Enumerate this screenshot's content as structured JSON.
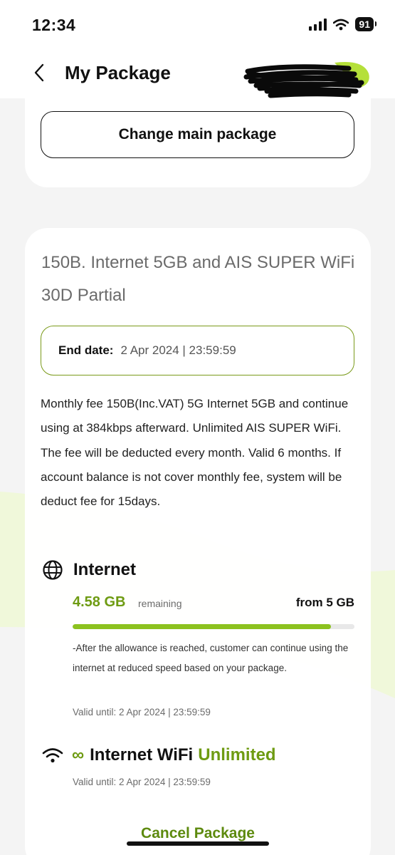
{
  "status_bar": {
    "time": "12:34",
    "battery": "91"
  },
  "header": {
    "title": "My Package"
  },
  "top_card": {
    "change_button_label": "Change main package"
  },
  "package": {
    "title": "150B. Internet 5GB and AIS SUPER WiFi 30D Partial",
    "end_date_label": "End date:",
    "end_date_value": "2 Apr 2024 | 23:59:59",
    "description": "Monthly fee 150B(Inc.VAT) 5G Internet 5GB and continue using at 384kbps afterward. Unlimited AIS SUPER WiFi. The fee will be deducted every month. Valid 6 months. If account balance is not cover monthly fee, system will be deduct fee for 15days."
  },
  "internet": {
    "name": "Internet",
    "remaining_value": "4.58 GB",
    "remaining_label": "remaining",
    "total": "from 5 GB",
    "remaining_fraction": 0.916,
    "note": "-After the allowance is reached, customer can continue using the internet at reduced speed based on your package.",
    "valid_until": "Valid until: 2 Apr 2024 | 23:59:59"
  },
  "wifi": {
    "infinity_symbol": "∞",
    "name": "Internet WiFi",
    "unlimited": "Unlimited",
    "valid_until": "Valid until: 2 Apr 2024 | 23:59:59"
  },
  "actions": {
    "cancel_label": "Cancel Package"
  },
  "colors": {
    "accent": "#8cc21f",
    "accent_text": "#6e9b12",
    "background": "#f4f4f4"
  },
  "icons": {
    "back": "chevron-left-icon",
    "globe": "globe-icon",
    "wifi": "wifi-icon",
    "signal": "cellular-signal-icon",
    "wifi_status": "wifi-status-icon",
    "battery": "battery-icon"
  }
}
